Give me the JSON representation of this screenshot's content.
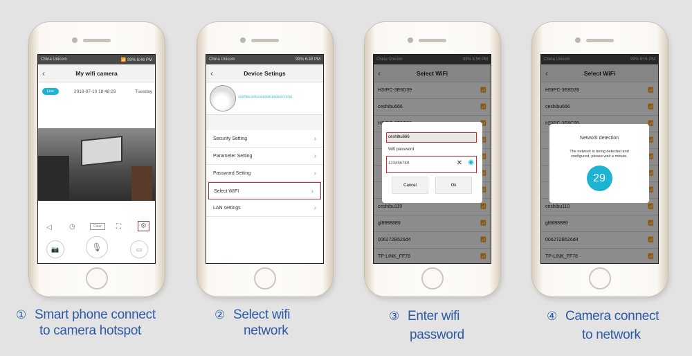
{
  "accent": "#1db3d3",
  "highlight": "#e0202a",
  "caption_color": "#2d5aa6",
  "status": {
    "carrier": "China Unicom",
    "battery": "99%",
    "times": [
      "6:46 PM",
      "6:48 PM",
      "6:50 PM",
      "6:51 PM"
    ]
  },
  "phone1": {
    "title": "My wifi camera",
    "live": "Live",
    "datetime": "2018-07-10 18:48:29",
    "weekday": "Tuesday",
    "clear": "Clear",
    "controls": [
      "mute-icon",
      "history-icon",
      "clear-button",
      "fullscreen-icon",
      "settings-icon"
    ],
    "actions": [
      "snapshot-icon",
      "microphone-icon",
      "record-icon"
    ]
  },
  "phone2": {
    "title": "Device Setings",
    "device_id": "40eff98c40fe10eb008cb8d2efe74f48",
    "items": [
      "Security Setting",
      "Parameter Setting",
      "Password Setting",
      "Select WIFI",
      "LAN settings"
    ],
    "selected_index": 3
  },
  "wifi_list": [
    "HSIPC-3E8D39",
    "ceshibu666",
    "HSIPC-3E8C95",
    "",
    "",
    "",
    "",
    "ceshibu110",
    "gl8888889",
    "006272B526d4",
    "TP-LINK_FF78"
  ],
  "phone3": {
    "title": "Select WiFi",
    "ssid": "ceshibu666",
    "password_label": "Wifi password",
    "password": "123456789",
    "cancel": "Cancel",
    "ok": "Ok"
  },
  "phone4": {
    "title": "Select WiFi",
    "dialog_title": "Network detection",
    "dialog_line1": "The network is being detected and",
    "dialog_line2": "configured, please wait a minute.",
    "countdown": "29"
  },
  "captions": [
    {
      "num": "①",
      "line1": "Smart phone connect",
      "line2": "to camera hotspot"
    },
    {
      "num": "②",
      "line1": "Select wifi",
      "line2": "network"
    },
    {
      "num": "③",
      "line1": "Enter wifi",
      "line2": "password"
    },
    {
      "num": "④",
      "line1": "Camera connect",
      "line2": "to network"
    }
  ]
}
